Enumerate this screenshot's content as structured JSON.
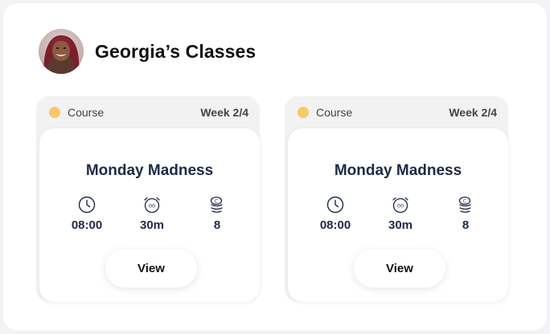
{
  "header": {
    "title": "Georgia’s Classes",
    "avatar_icon": "user-avatar"
  },
  "colors": {
    "course_dot": "#f7c96a",
    "text_dark": "#1c2b46"
  },
  "cards": [
    {
      "tag": "Course",
      "week": "Week 2/4",
      "name": "Monday Madness",
      "stats": [
        {
          "icon": "clock-icon",
          "value": "08:00"
        },
        {
          "icon": "alarm-icon",
          "value": "30m"
        },
        {
          "icon": "coins-icon",
          "value": "8"
        }
      ],
      "button": "View"
    },
    {
      "tag": "Course",
      "week": "Week 2/4",
      "name": "Monday Madness",
      "stats": [
        {
          "icon": "clock-icon",
          "value": "08:00"
        },
        {
          "icon": "alarm-icon",
          "value": "30m"
        },
        {
          "icon": "coins-icon",
          "value": "8"
        }
      ],
      "button": "View"
    }
  ]
}
